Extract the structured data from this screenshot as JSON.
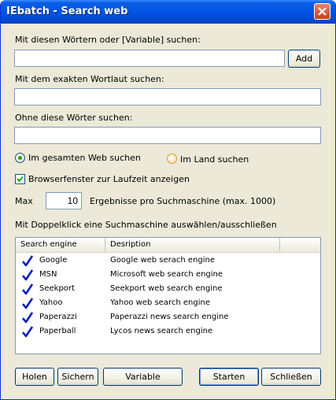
{
  "window": {
    "title": "IEbatch - Search web"
  },
  "search_words": {
    "label": "Mit diesen Wörtern oder [Variable] suchen:",
    "value": "",
    "add_button": "Add"
  },
  "exact_phrase": {
    "label": "Mit dem exakten Wortlaut suchen:",
    "value": ""
  },
  "exclude_words": {
    "label": "Ohne diese Wörter suchen:",
    "value": ""
  },
  "scope": {
    "option_web": "Im gesamten Web suchen",
    "option_country": "Im Land suchen",
    "selected": "web"
  },
  "show_browser": {
    "label": "Browserfenster zur Laufzeit anzeigen",
    "checked": true
  },
  "max_results": {
    "prefix": "Max",
    "value": "10",
    "suffix": "Ergebnisse pro Suchmaschine (max. 1000)"
  },
  "engines_hint": "Mit Doppelklick eine Suchmaschine auswählen/ausschließen",
  "engines": {
    "columns": [
      "Search engine",
      "Desription"
    ],
    "rows": [
      {
        "name": "Google",
        "description": "Google web serach engine",
        "checked": true
      },
      {
        "name": "MSN",
        "description": "Microsoft web search engine",
        "checked": true
      },
      {
        "name": "Seekport",
        "description": "Seekport web search engine",
        "checked": true
      },
      {
        "name": "Yahoo",
        "description": "Yahoo web search engine",
        "checked": true
      },
      {
        "name": "Paperazzi",
        "description": "Paperazzi news search engine",
        "checked": true
      },
      {
        "name": "Paperball",
        "description": "Lycos news search engine",
        "checked": true
      }
    ]
  },
  "buttons": {
    "load": "Holen",
    "save": "Sichern",
    "variable": "Variable",
    "start": "Starten",
    "close": "Schließen"
  },
  "colors": {
    "titlebar": "#0054e3",
    "dialog_bg": "#ece9d8",
    "check_blue": "#0a1fbf"
  }
}
